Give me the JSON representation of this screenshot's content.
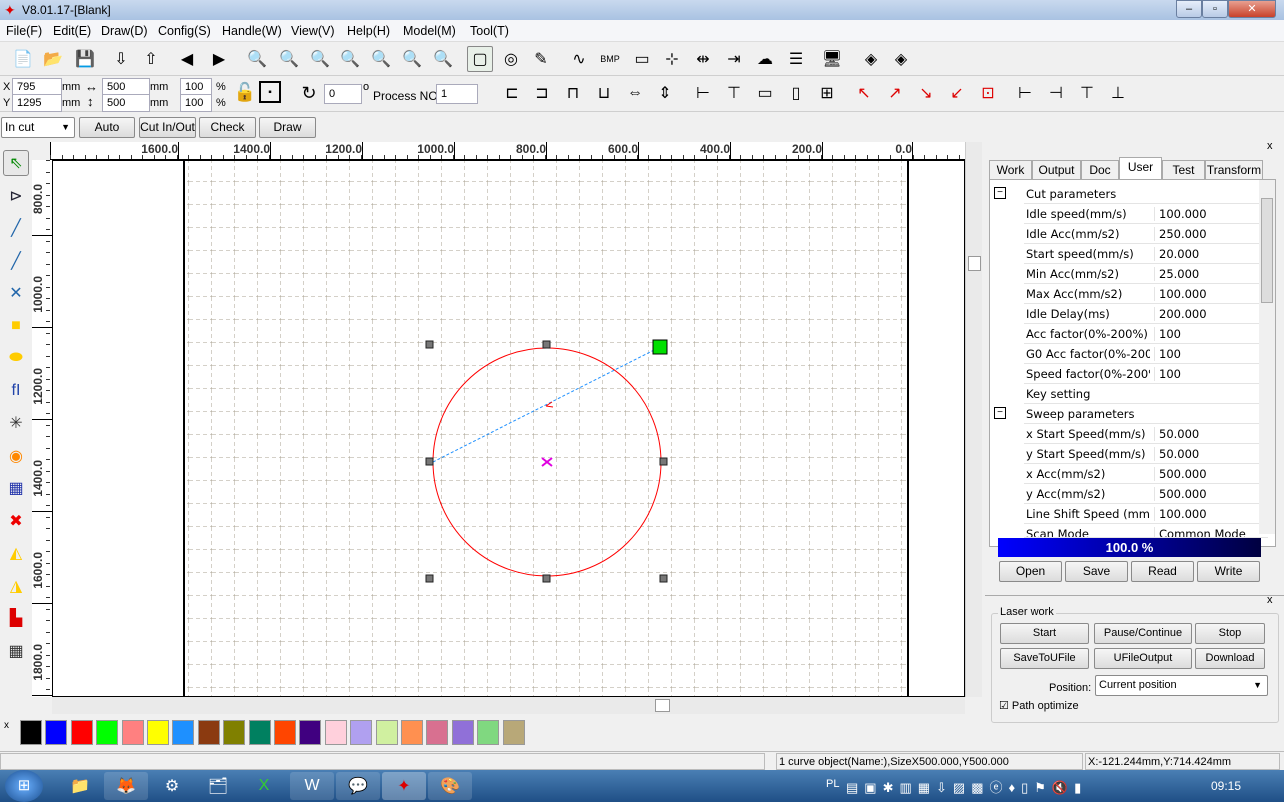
{
  "window": {
    "title": "V8.01.17-[Blank]",
    "minimize": "–",
    "maximize": "▫",
    "close": "✕"
  },
  "menu": [
    "File(F)",
    "Edit(E)",
    "Draw(D)",
    "Config(S)",
    "Handle(W)",
    "View(V)",
    "Help(H)",
    "Model(M)",
    "Tool(T)"
  ],
  "toolbar1": [
    "new-file-icon",
    "open-folder-icon",
    "save-icon",
    "import-icon",
    "export-icon",
    "back-icon",
    "forward-icon",
    "zoom-pan-icon",
    "zoom-in-icon",
    "zoom-out-icon",
    "zoom-page-icon",
    "zoom-select-icon",
    "zoom-all-icon",
    "zoom-icon",
    "select-frame-icon",
    "origin-icon",
    "pen-icon",
    "curve-smooth-icon",
    "bmp-icon",
    "rectangle-tool-icon",
    "node-icon",
    "array-icon",
    "move-icon",
    "cloud-icon",
    "list-icon",
    "monitor-icon",
    "object-icon",
    "object2-icon"
  ],
  "position": {
    "x_label": "X",
    "y_label": "Y",
    "x": "795",
    "y": "1295",
    "unit": "mm",
    "width": "500",
    "height": "500",
    "scale_x": "100",
    "scale_y": "100",
    "pct": "%",
    "rotation": "0",
    "degree": "o",
    "process_label": "Process NO:",
    "process_no": "1"
  },
  "toolbar2": [
    "align-left-icon",
    "align-right-icon",
    "align-top-icon",
    "align-bottom-icon",
    "center-h-icon",
    "center-v-icon",
    "space-h-icon",
    "space-v-icon",
    "same-width-icon",
    "same-height-icon",
    "same-size-icon",
    "top-left-icon",
    "top-right-icon",
    "bottom-right-icon",
    "bottom-left-icon",
    "center-icon",
    "left-edge-icon",
    "right-edge-icon",
    "top-edge-icon",
    "bottom-edge-icon"
  ],
  "toolbar3": {
    "mode": "In cut",
    "buttons": [
      "Auto",
      "Cut In/Out",
      "Check",
      "Draw"
    ]
  },
  "ruler_top": [
    "800.0",
    "1600.0",
    "1400.0",
    "1200.0",
    "1000.0",
    "800.0",
    "600.0",
    "400.0",
    "200.0",
    "0.0"
  ],
  "ruler_left": [
    "800.0",
    "1000.0",
    "1200.0",
    "1400.0",
    "1600.0",
    "1800.0"
  ],
  "toolbox": [
    "select-icon",
    "node-edit-icon",
    "line-icon",
    "polyline-icon",
    "bezier-icon",
    "rectangle-icon",
    "ellipse-icon",
    "text-icon",
    "point-icon",
    "bitmap-icon",
    "grid-array-icon",
    "delete-icon",
    "mirror-h-icon",
    "mirror-v-icon",
    "laser-head-icon",
    "array-copy-icon"
  ],
  "shape": {
    "color": "#ff0000",
    "selected": true,
    "description": "circle"
  },
  "palette": [
    "#000000",
    "#0000ff",
    "#ff0000",
    "#00ff00",
    "#ff8080",
    "#ffff00",
    "#1e90ff",
    "#8b3a10",
    "#808000",
    "#008060",
    "#ff4500",
    "#400080",
    "#ffd0dc",
    "#b0a0f0",
    "#d0f0a0",
    "#ff9050",
    "#d87090",
    "#9070d8",
    "#80d880",
    "#b8a878"
  ],
  "panel": {
    "tabs": [
      "Work",
      "Output",
      "Doc",
      "User",
      "Test",
      "Transform"
    ],
    "active_tab": "User",
    "rows": [
      {
        "k": "Cut parameters",
        "v": "",
        "group": true
      },
      {
        "k": "Idle speed(mm/s)",
        "v": "100.000"
      },
      {
        "k": "Idle Acc(mm/s2)",
        "v": "250.000"
      },
      {
        "k": "Start speed(mm/s)",
        "v": "20.000"
      },
      {
        "k": "Min Acc(mm/s2)",
        "v": "25.000"
      },
      {
        "k": "Max Acc(mm/s2)",
        "v": "100.000"
      },
      {
        "k": "Idle Delay(ms)",
        "v": "200.000"
      },
      {
        "k": "Acc factor(0%-200%)",
        "v": "100"
      },
      {
        "k": "G0 Acc factor(0%-200",
        "v": "100"
      },
      {
        "k": "Speed factor(0%-200%",
        "v": "100"
      },
      {
        "k": "Key setting",
        "v": ""
      },
      {
        "k": "Sweep parameters",
        "v": "",
        "group": true
      },
      {
        "k": "x Start Speed(mm/s)",
        "v": "50.000"
      },
      {
        "k": "y Start Speed(mm/s)",
        "v": "50.000"
      },
      {
        "k": "x Acc(mm/s2)",
        "v": "500.000"
      },
      {
        "k": "y Acc(mm/s2)",
        "v": "500.000"
      },
      {
        "k": "Line Shift Speed (mm/",
        "v": "100.000"
      },
      {
        "k": "Scan Mode",
        "v": "Common Mode"
      }
    ],
    "progress": "100.0  %",
    "progress_value": 100,
    "buttons": [
      "Open",
      "Save",
      "Read",
      "Write"
    ],
    "laser_title": "Laser work",
    "laser_buttons": [
      "Start",
      "Pause/Continue",
      "Stop",
      "SaveToUFile",
      "UFileOutput",
      "Download"
    ],
    "position_label": "Position:",
    "position_value": "Current position",
    "path_opt": "Path optimize"
  },
  "status": {
    "object": "1 curve object(Name:),SizeX500.000,Y500.000",
    "coords": "X:-121.244mm,Y:714.424mm"
  },
  "taskbar": {
    "lang": "PL",
    "time": "09:15"
  }
}
